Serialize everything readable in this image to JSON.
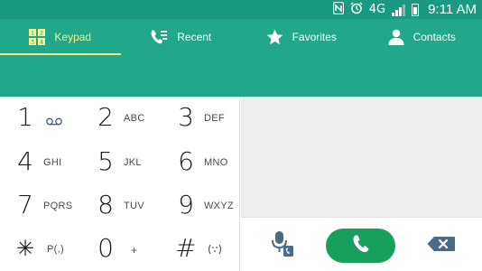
{
  "status_bar": {
    "time": "9:11 AM",
    "icons": [
      "nfc-icon",
      "alarm-icon",
      "4g-lte-icon",
      "signal-icon",
      "battery-icon"
    ],
    "network": "4G"
  },
  "tabs": [
    {
      "label": "Keypad",
      "icon": "keypad-icon",
      "active": true
    },
    {
      "label": "Recent",
      "icon": "recent-calls-icon",
      "active": false
    },
    {
      "label": "Favorites",
      "icon": "star-icon",
      "active": false
    },
    {
      "label": "Contacts",
      "icon": "person-icon",
      "active": false
    }
  ],
  "keypad": {
    "keys": [
      {
        "digit": "1",
        "sub": ""
      },
      {
        "digit": "2",
        "sub": "ABC"
      },
      {
        "digit": "3",
        "sub": "DEF"
      },
      {
        "digit": "4",
        "sub": "GHI"
      },
      {
        "digit": "5",
        "sub": "JKL"
      },
      {
        "digit": "6",
        "sub": "MNO"
      },
      {
        "digit": "7",
        "sub": "PQRS"
      },
      {
        "digit": "8",
        "sub": "TUV"
      },
      {
        "digit": "9",
        "sub": "WXYZ"
      },
      {
        "digit": "✳",
        "sub": "P(,)"
      },
      {
        "digit": "0",
        "sub": "+"
      },
      {
        "digit": "#",
        "sub": ""
      }
    ]
  },
  "colors": {
    "status_bar": "#1a9a80",
    "header": "#21a78a",
    "active_tab": "#fbef8e",
    "call_button": "#17a05d",
    "icon_blue": "#4a6a86"
  }
}
